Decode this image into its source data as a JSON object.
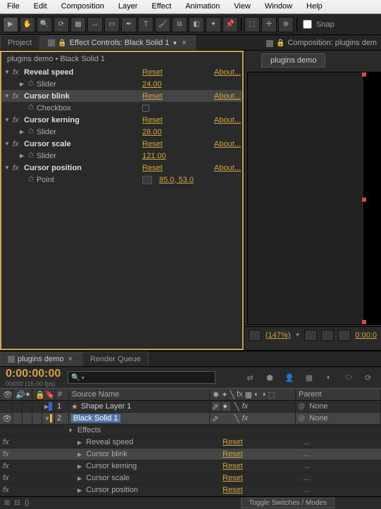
{
  "menu": [
    "File",
    "Edit",
    "Composition",
    "Layer",
    "Effect",
    "Animation",
    "View",
    "Window",
    "Help"
  ],
  "snap_label": "Snap",
  "tabs": {
    "project": "Project",
    "effect_controls": "Effect Controls: Black Solid 1",
    "composition": "Composition: plugins dem"
  },
  "panel_path": "plugins demo • Black Solid 1",
  "effects": [
    {
      "name": "Reveal speed",
      "reset": "Reset",
      "about": "About...",
      "bold": true,
      "props": [
        {
          "label": "Slider",
          "value": "24.00",
          "type": "slider"
        }
      ]
    },
    {
      "name": "Cursor blink",
      "reset": "Reset",
      "about": "About...",
      "bold": true,
      "selected": true,
      "props": [
        {
          "label": "Checkbox",
          "type": "checkbox"
        }
      ]
    },
    {
      "name": "Cursor kerning",
      "reset": "Reset",
      "about": "About...",
      "bold": true,
      "props": [
        {
          "label": "Slider",
          "value": "28.00",
          "type": "slider"
        }
      ]
    },
    {
      "name": "Cursor scale",
      "reset": "Reset",
      "about": "About...",
      "bold": true,
      "props": [
        {
          "label": "Slider",
          "value": "121.00",
          "type": "slider"
        }
      ]
    },
    {
      "name": "Cursor position",
      "reset": "Reset",
      "about": "About...",
      "bold": true,
      "props": [
        {
          "label": "Point",
          "value": "85.0, 53.0",
          "type": "point"
        }
      ]
    }
  ],
  "comp_subtab": "plugins demo",
  "viewer": {
    "zoom": "(147%)",
    "time": "0:00:0"
  },
  "timeline": {
    "tab_comp": "plugins demo",
    "tab_render": "Render Queue",
    "timecode": "0:00:00:00",
    "timecode_sub": "00000 (15.00 fps)",
    "col_num": "#",
    "col_source": "Source Name",
    "col_parent": "Parent",
    "layers": [
      {
        "num": "1",
        "name": "Shape Layer 1",
        "color": "#3a5fd9",
        "star": true,
        "parent": "None"
      },
      {
        "num": "2",
        "name": "Black Solid 1",
        "color": "#d9c23a",
        "selected": true,
        "parent": "None"
      }
    ],
    "effects_label": "Effects",
    "layer_effects": [
      {
        "name": "Reveal speed",
        "reset": "Reset"
      },
      {
        "name": "Cursor blink",
        "reset": "Reset",
        "selected": true
      },
      {
        "name": "Cursor kerning",
        "reset": "Reset"
      },
      {
        "name": "Cursor scale",
        "reset": "Reset"
      },
      {
        "name": "Cursor position",
        "reset": "Reset"
      }
    ],
    "toggle_label": "Toggle Switches / Modes"
  }
}
